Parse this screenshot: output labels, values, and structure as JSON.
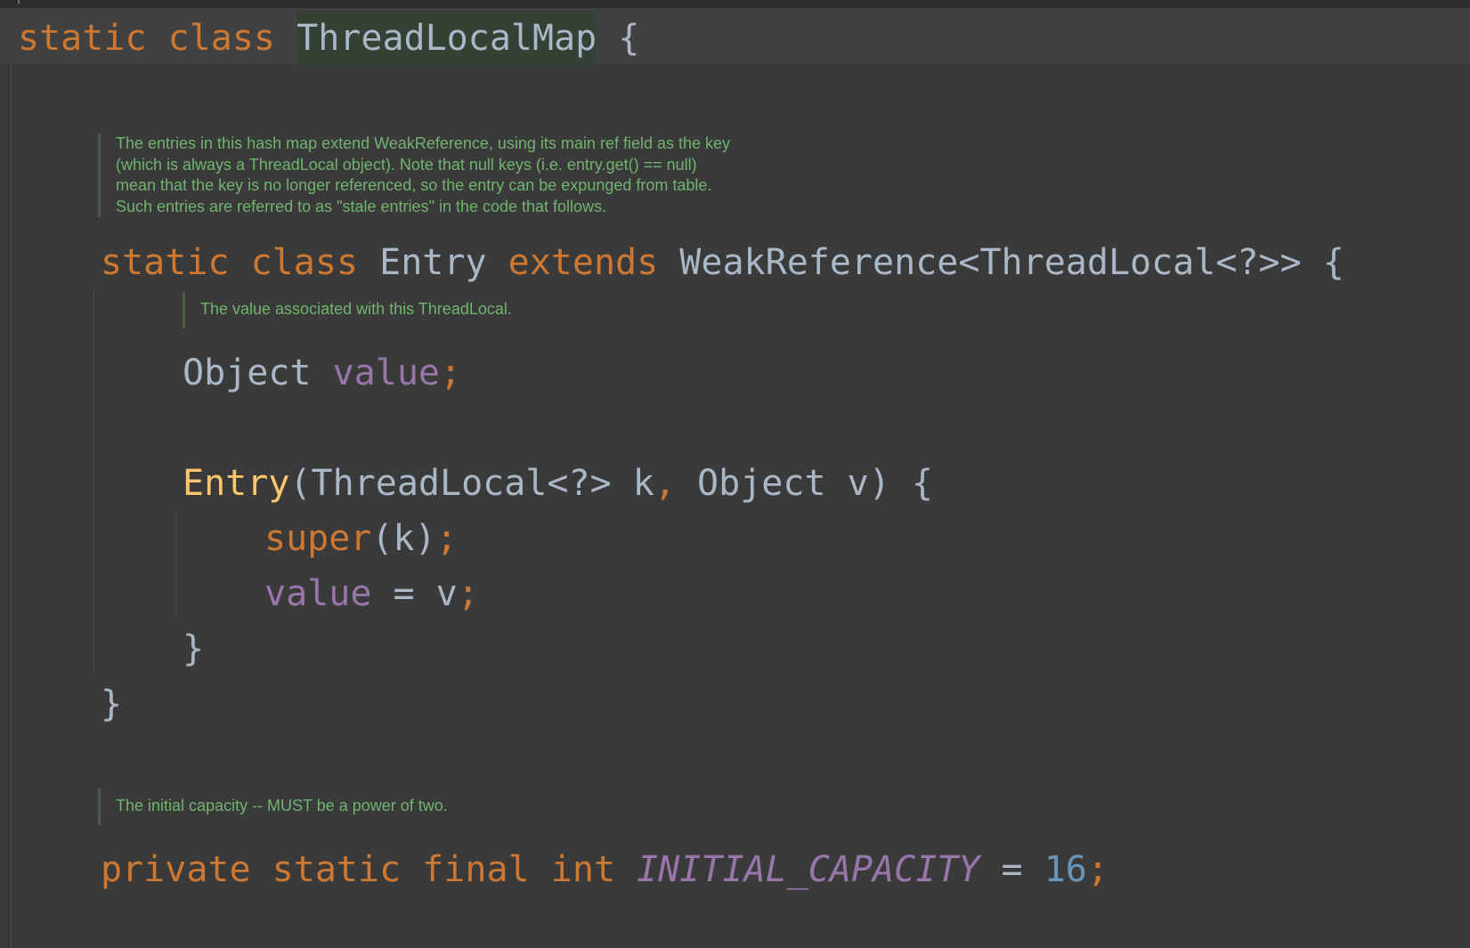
{
  "colors": {
    "background": "#3a3a3a",
    "keyword": "#cc7832",
    "class_name": "#a9b7c6",
    "field": "#9876aa",
    "method": "#ffc66d",
    "number": "#6897bb",
    "doc_comment": "#71b36f",
    "highlight": "#344134"
  },
  "line1": {
    "kw_static": "static",
    "kw_class": "class",
    "class_name": "ThreadLocalMap",
    "brace": "{"
  },
  "doc1": {
    "lines": [
      "The entries in this hash map extend WeakReference, using its main ref field as the key",
      "(which is always a ThreadLocal object). Note that null keys (i.e. entry.get() == null)",
      "mean that the key is no longer referenced, so the entry can be expunged from table.",
      "Such entries are referred to as \"stale entries\" in the code that follows."
    ]
  },
  "entry_decl": {
    "kw_static": "static",
    "kw_class": "class",
    "class_name": "Entry",
    "kw_extends": "extends",
    "super_type": "WeakReference<ThreadLocal<?>>",
    "brace": "{"
  },
  "doc2": {
    "lines": [
      "The value associated with this ThreadLocal."
    ]
  },
  "value_field": {
    "type": "Object",
    "name": "value",
    "semi": ";"
  },
  "constructor": {
    "name": "Entry",
    "open_paren": "(",
    "param1_type": "ThreadLocal<?>",
    "param1_name": "k",
    "comma": ",",
    "param2_type": "Object",
    "param2_name": "v",
    "close": ") {"
  },
  "super_call": {
    "kw": "super",
    "args": "(k)",
    "semi": ";"
  },
  "assignment": {
    "field": "value",
    "op": " = v",
    "semi": ";"
  },
  "close_inner": "}",
  "close_outer": "}",
  "doc3": {
    "lines": [
      "The initial capacity -- MUST be a power of two."
    ]
  },
  "capacity": {
    "kw_private": "private",
    "kw_static": "static",
    "kw_final": "final",
    "kw_int": "int",
    "name": "INITIAL_CAPACITY",
    "op": " = ",
    "value": "16",
    "semi": ";"
  }
}
